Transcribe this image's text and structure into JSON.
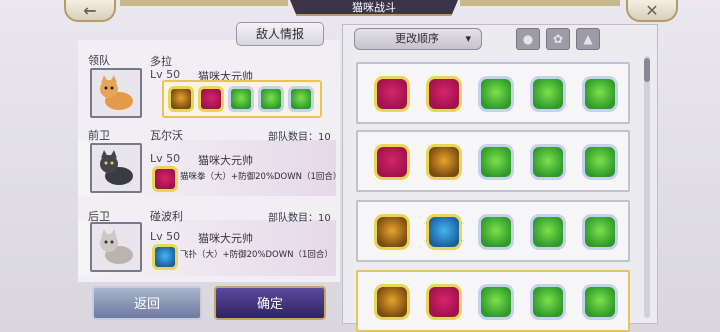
{
  "header": {
    "title": "猫咪战斗"
  },
  "buttons": {
    "intel": "敌人情报",
    "sort": "更改顺序",
    "back": "返回",
    "confirm": "确定"
  },
  "left": {
    "leader": {
      "role": "领队",
      "name": "多拉",
      "level": "Lv 50",
      "title": "猫咪大元帅"
    },
    "front": {
      "role": "前卫",
      "name": "瓦尔沃",
      "level": "Lv 50",
      "title": "猫咪大元帅",
      "count": "部队数目：10",
      "skill": "猫咪拳（大）+防御20%DOWN（1回合）"
    },
    "rear": {
      "role": "后卫",
      "name": "碰波利",
      "level": "Lv 50",
      "title": "猫咪大元帅",
      "count": "部队数目：10",
      "skill": "飞扑（大）+防御20%DOWN（1回合）"
    }
  },
  "teams": [
    {
      "skills": [
        "pink",
        "pink",
        "green",
        "green",
        "green"
      ]
    },
    {
      "skills": [
        "pink",
        "gold",
        "green",
        "green",
        "green"
      ]
    },
    {
      "skills": [
        "gold",
        "blue",
        "green",
        "green",
        "green"
      ]
    },
    {
      "skills": [
        "gold",
        "pink",
        "green",
        "green",
        "green"
      ]
    }
  ],
  "icons": {
    "back": "back-arrow-icon",
    "close": "close-icon",
    "filters": [
      "claw-filter-icon",
      "paw-filter-icon",
      "cat-filter-icon"
    ]
  }
}
